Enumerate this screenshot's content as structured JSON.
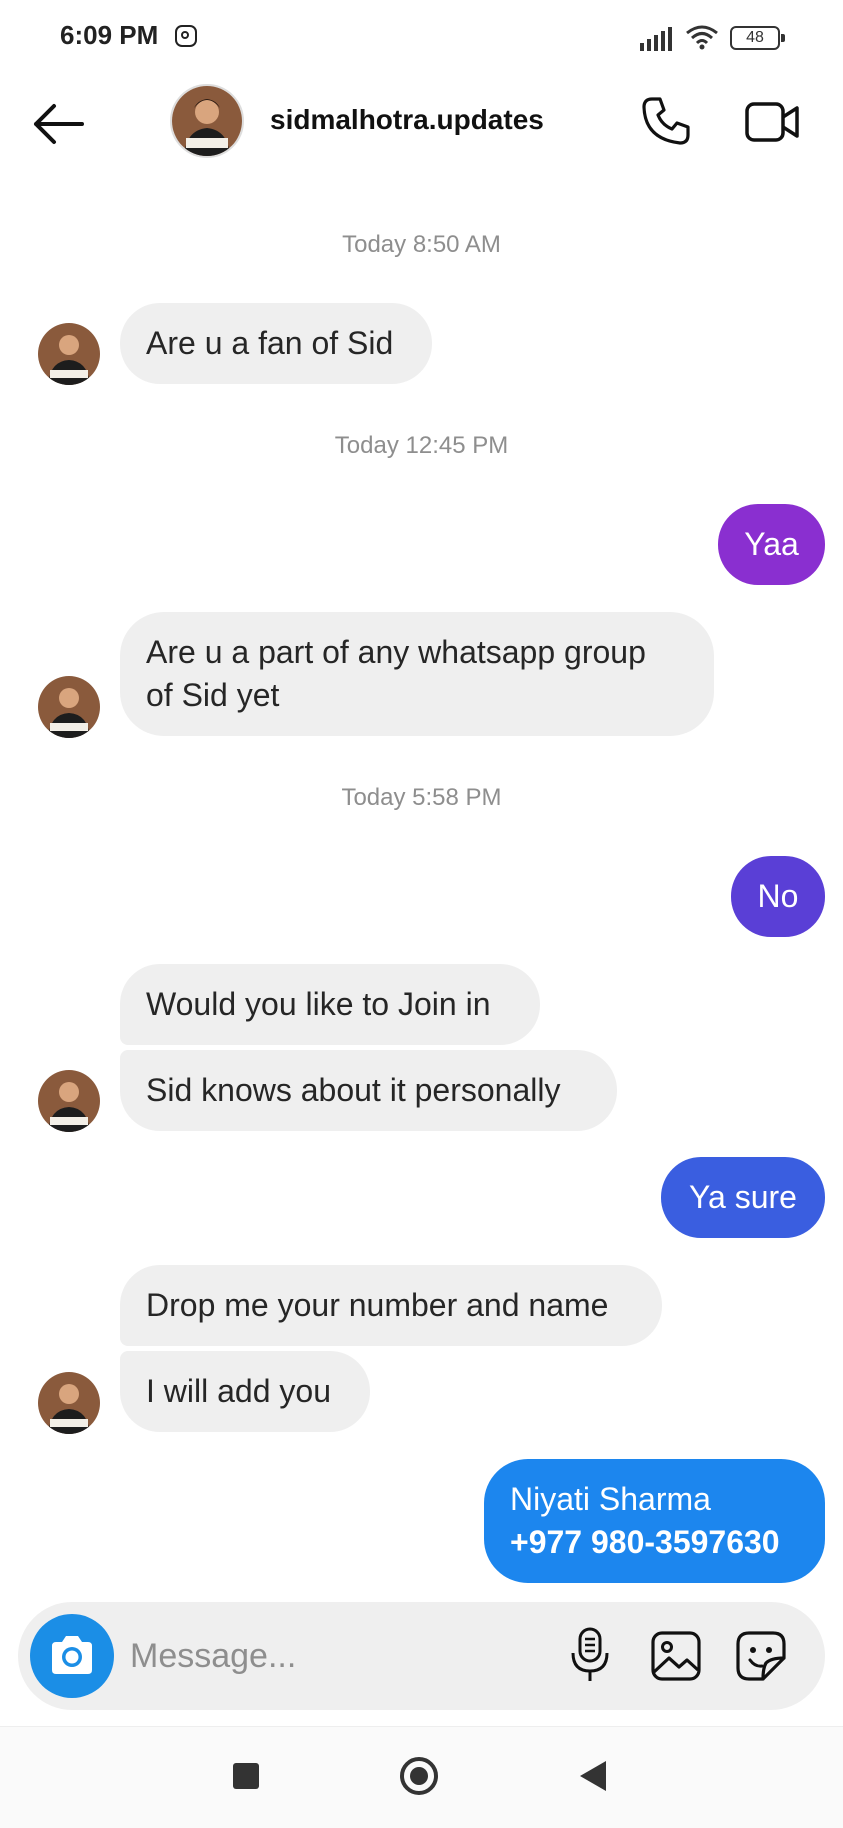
{
  "status_bar": {
    "time": "6:09 PM",
    "battery": "48",
    "icons": [
      "instagram-icon",
      "signal-icon",
      "wifi-icon",
      "battery-icon"
    ]
  },
  "header": {
    "username": "sidmalhotra.updates",
    "icons": [
      "back-arrow-icon",
      "phone-icon",
      "video-camera-icon"
    ]
  },
  "conversation": {
    "timestamps": [
      "Today 8:50 AM",
      "Today 12:45 PM",
      "Today 5:58 PM"
    ],
    "messages": [
      {
        "from": "them",
        "text": "Are u a fan of Sid"
      },
      {
        "from": "me",
        "text": "Yaa",
        "color": "#8a2fd0"
      },
      {
        "from": "them",
        "line1": "Are u a part of any whatsapp group",
        "line2": "of Sid yet"
      },
      {
        "from": "me",
        "text": "No",
        "color": "#5a3fd6"
      },
      {
        "from": "them",
        "text": "Would you like to Join in"
      },
      {
        "from": "them",
        "text": "Sid knows about it personally"
      },
      {
        "from": "me",
        "text": "Ya sure",
        "color": "#3a5ee0"
      },
      {
        "from": "them",
        "text": "Drop me your number and name"
      },
      {
        "from": "them",
        "text": "I will add you"
      },
      {
        "from": "me",
        "line1": "Niyati Sharma",
        "line2": "+977 980-3597630",
        "color": "#1c86ee"
      }
    ]
  },
  "composer": {
    "placeholder": "Message...",
    "icons": [
      "camera-icon",
      "microphone-icon",
      "gallery-icon",
      "sticker-icon"
    ]
  },
  "nav_bar": {
    "icons": [
      "recent-apps-icon",
      "home-icon",
      "back-icon"
    ]
  }
}
